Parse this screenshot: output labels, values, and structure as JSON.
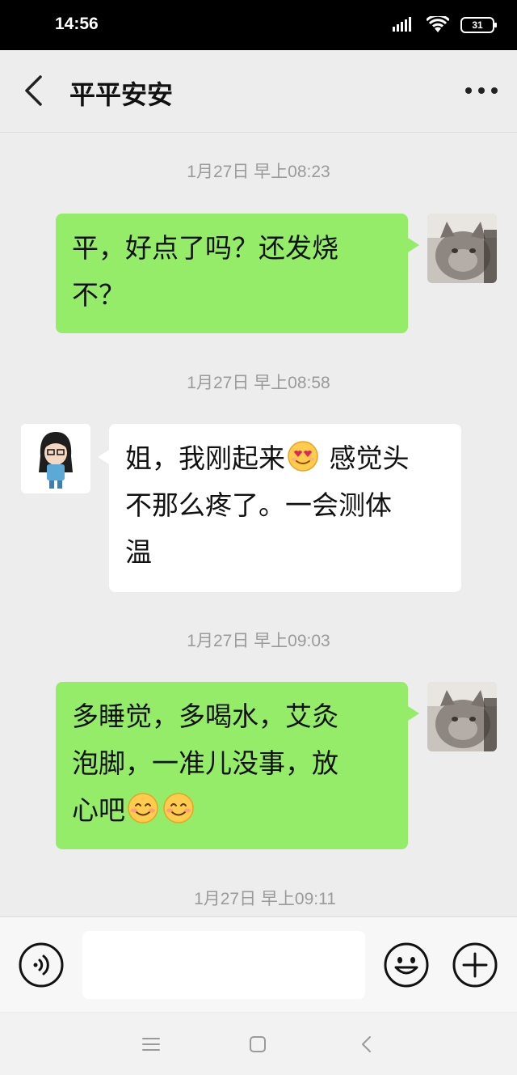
{
  "status_bar": {
    "time": "14:56",
    "battery": "31",
    "icons": [
      "signal-icon",
      "wifi-icon",
      "battery-icon"
    ]
  },
  "header": {
    "title": "平平安安",
    "back_icon": "chevron-left-icon",
    "more_icon": "more-dots-icon"
  },
  "messages": [
    {
      "type": "timestamp",
      "text": "1月27日 早上08:23"
    },
    {
      "type": "message",
      "sender": "me",
      "lines": [
        "平，好点了吗？还发烧",
        "不？"
      ]
    },
    {
      "type": "timestamp",
      "text": "1月27日 早上08:58"
    },
    {
      "type": "message",
      "sender": "contact",
      "line1_before": "姐，我刚起来",
      "line1_emoji": "heart-eyes-emoji",
      "line1_after": " 感觉头",
      "line2": "不那么疼了。一会测体",
      "line3": "温"
    },
    {
      "type": "timestamp",
      "text": "1月27日 早上09:03"
    },
    {
      "type": "message",
      "sender": "me",
      "line1": "多睡觉，多喝水，艾灸",
      "line2": "泡脚，一准儿没事，放",
      "line3_text": "心吧",
      "line3_emojis": [
        "smile-emoji",
        "smile-emoji"
      ]
    },
    {
      "type": "timestamp",
      "text": "1月27日 早上09:11"
    }
  ],
  "input_bar": {
    "placeholder": "",
    "voice_icon": "voice-icon",
    "emoji_icon": "emoji-icon",
    "plus_icon": "plus-icon"
  },
  "nav_bar": {
    "icons": [
      "menu-icon",
      "home-icon",
      "back-icon"
    ]
  },
  "colors": {
    "my_bubble": "#95ec69",
    "their_bubble": "#ffffff",
    "background": "#ededed"
  }
}
